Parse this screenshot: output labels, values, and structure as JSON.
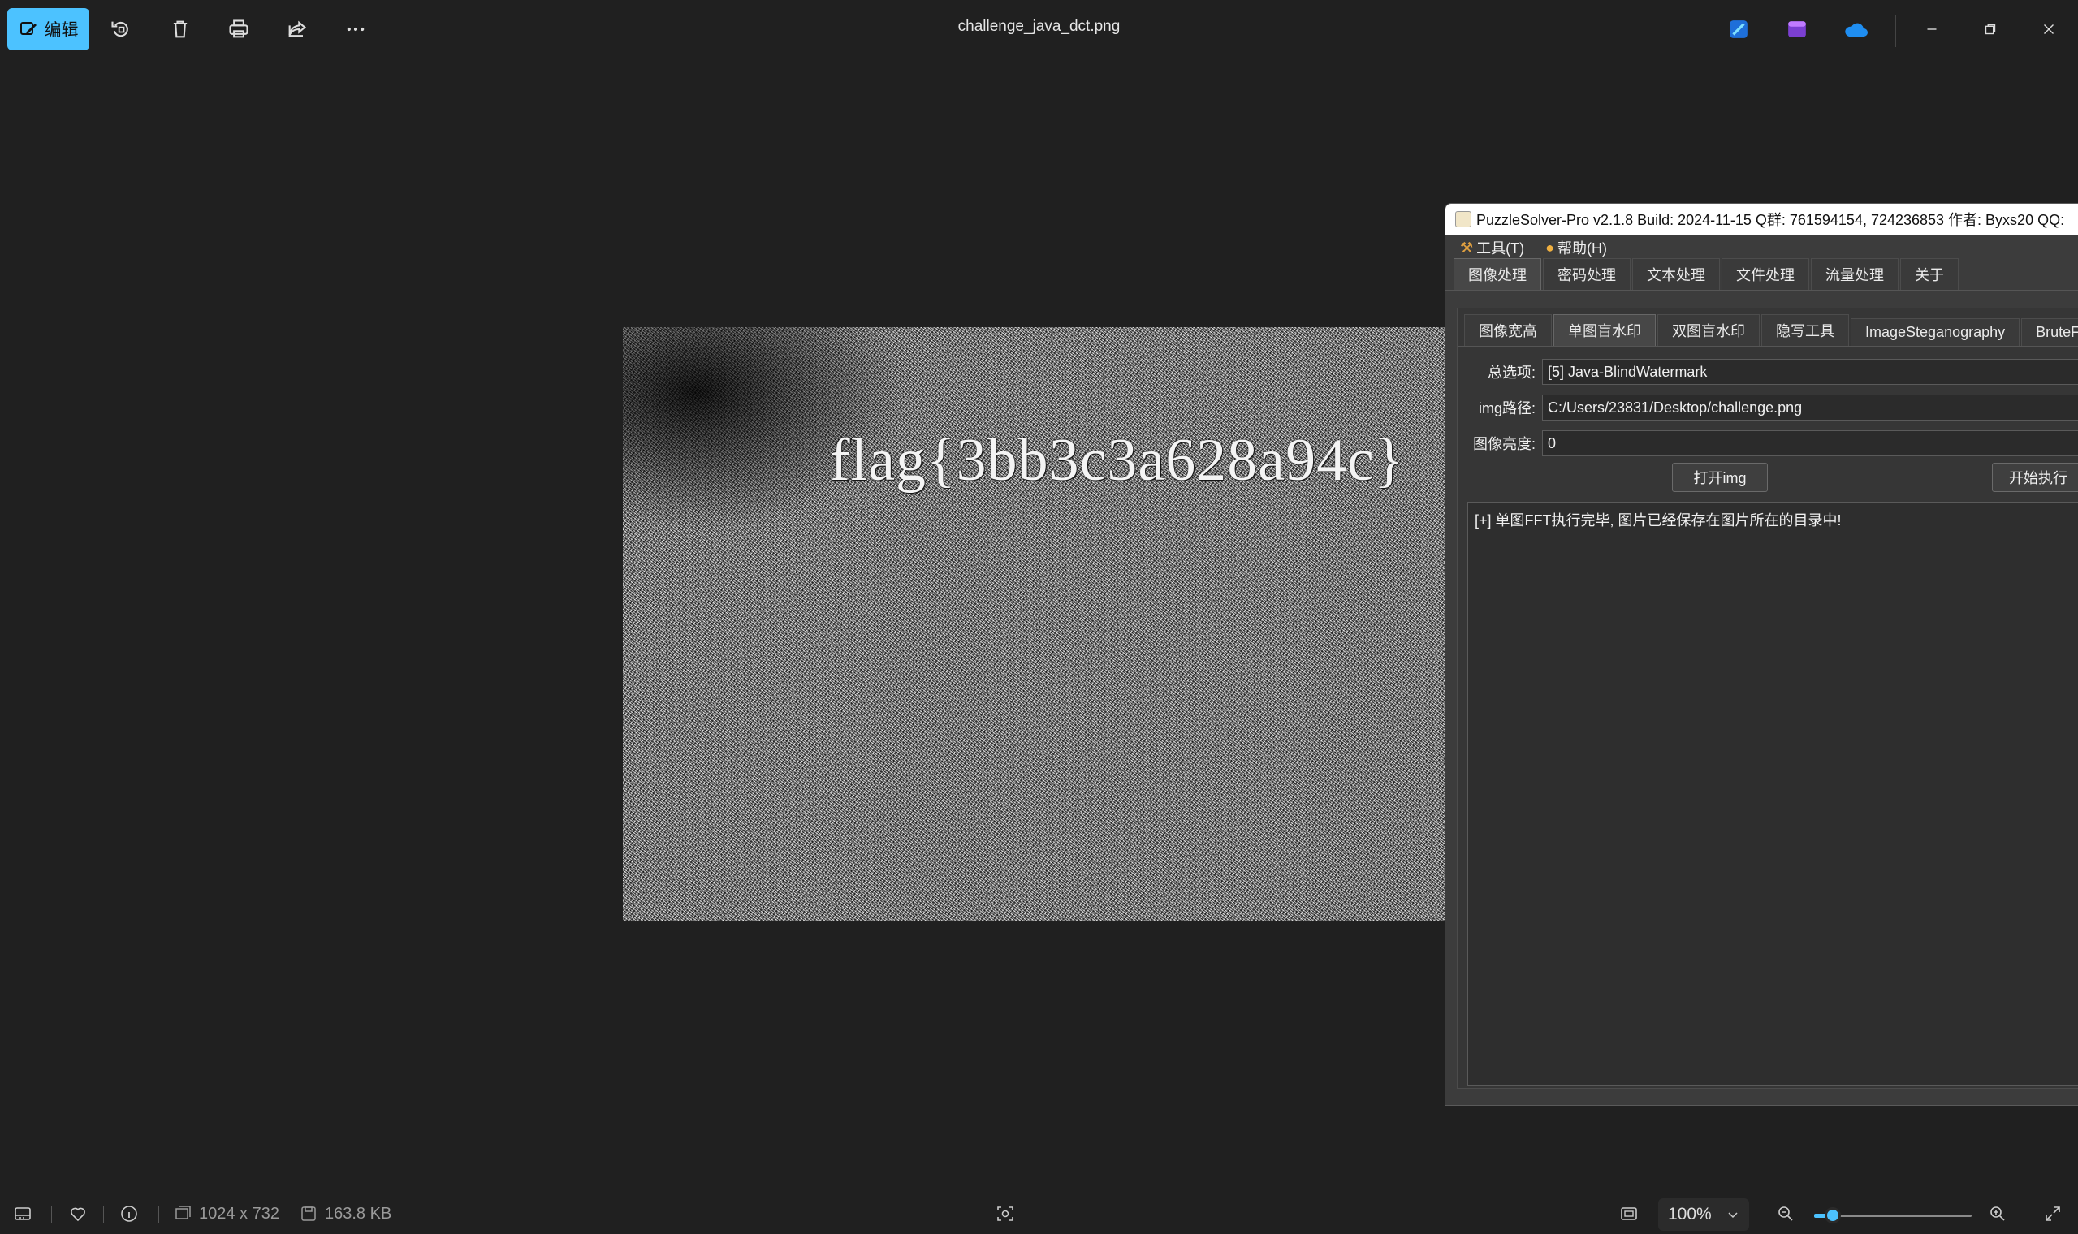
{
  "app": {
    "title": "challenge_java_dct.png",
    "edit_label": "编辑"
  },
  "toolbar_icons": [
    "rotate-icon",
    "delete-icon",
    "print-icon",
    "share-icon",
    "more-icon"
  ],
  "photo": {
    "overlay_text": "flag{3bb3c3a628a94c}"
  },
  "puzzle": {
    "title": "PuzzleSolver-Pro v2.1.8  Build: 2024-11-15  Q群: 761594154, 724236853  作者: Byxs20  QQ:",
    "menus": [
      "工具(T)",
      "帮助(H)"
    ],
    "main_tabs": [
      "图像处理",
      "密码处理",
      "文本处理",
      "文件处理",
      "流量处理",
      "关于"
    ],
    "sub_tabs": [
      "图像宽高",
      "单图盲水印",
      "双图盲水印",
      "隐写工具",
      "ImageSteganography",
      "BruteF"
    ],
    "option_label": "总选项:",
    "option_value": "[5] Java-BlindWatermark",
    "path_label": "img路径:",
    "path_value": "C:/Users/23831/Desktop/challenge.png",
    "brightness_label": "图像亮度:",
    "brightness_value": "0",
    "open_button": "打开img",
    "run_button": "开始执行",
    "output_text": "[+] 单图FFT执行完毕, 图片已经保存在图片所在的目录中!"
  },
  "status": {
    "dimensions": "1024 x 732",
    "file_size": "163.8 KB",
    "zoom": "100%",
    "zoom_level_fraction": 0.12
  },
  "colors": {
    "accent": "#4cc2ff",
    "background": "#202020"
  }
}
